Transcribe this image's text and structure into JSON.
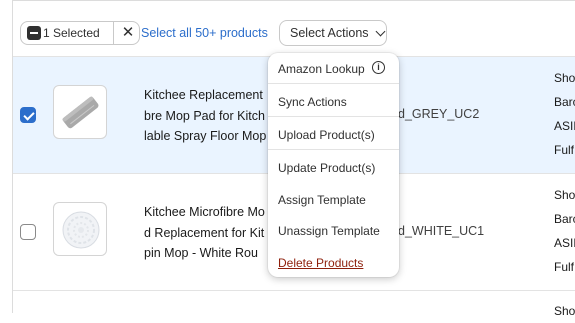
{
  "toolbar": {
    "selected_count_label": "1 Selected",
    "clear_icon": "close-icon",
    "select_all_label": "Select all 50+ products",
    "actions_label": "Select Actions"
  },
  "menu": {
    "items": [
      {
        "label": "Amazon Lookup",
        "icon": "info-icon"
      },
      {
        "label": "Sync Actions"
      },
      {
        "label": "Upload Product(s)"
      },
      {
        "label": "Update Product(s)"
      },
      {
        "label": "Assign Template"
      },
      {
        "label": "Unassign Template"
      },
      {
        "label": "Delete Products",
        "destructive": true
      }
    ],
    "info_glyph": "i"
  },
  "products": [
    {
      "selected": true,
      "title_lines": [
        "Kitchee Replacement",
        "bre Mop Pad for Kitch",
        "lable Spray Floor Mop"
      ],
      "sku": "d_GREY_UC2",
      "meta": [
        "Sho",
        "Barc",
        "ASIN",
        "Fulf"
      ]
    },
    {
      "selected": false,
      "title_lines": [
        "Kitchee Microfibre Mo",
        "d Replacement for Kit",
        "pin Mop - White Rou"
      ],
      "sku": "d_WHITE_UC1",
      "meta": [
        "Sho",
        "Barc",
        "ASIN",
        "Fulf"
      ]
    },
    {
      "selected": false,
      "meta": [
        "Sho"
      ]
    }
  ],
  "colors": {
    "selected_row_bg": "#eaf4ff",
    "link_blue": "#2c6ecb",
    "destructive": "#8e1f0b"
  }
}
